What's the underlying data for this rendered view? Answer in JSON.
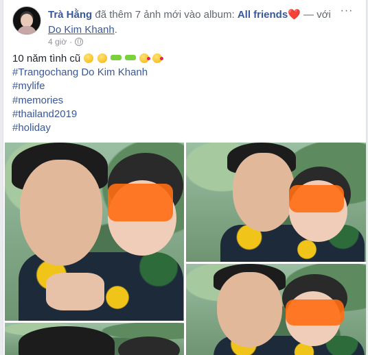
{
  "post": {
    "author": "Trà Hằng",
    "action_text": " đã thêm 7 ảnh mới vào album: ",
    "album_name": "All friends",
    "with_text": " — với ",
    "tagged_name": "Do Kim Khanh",
    "period": ".",
    "time": "4 giờ",
    "privacy_icon": "globe-icon",
    "more_icon": "more-options-icon",
    "caption": "10 năm tình cũ",
    "hashtags": [
      "#Trangochang Do Kim Khanh",
      "#mylife",
      "#memories",
      "#thailand2019",
      "#holiday"
    ],
    "photo_count": 4
  },
  "colors": {
    "link": "#385898",
    "meta": "#90949c",
    "heart": "#e0245e"
  }
}
